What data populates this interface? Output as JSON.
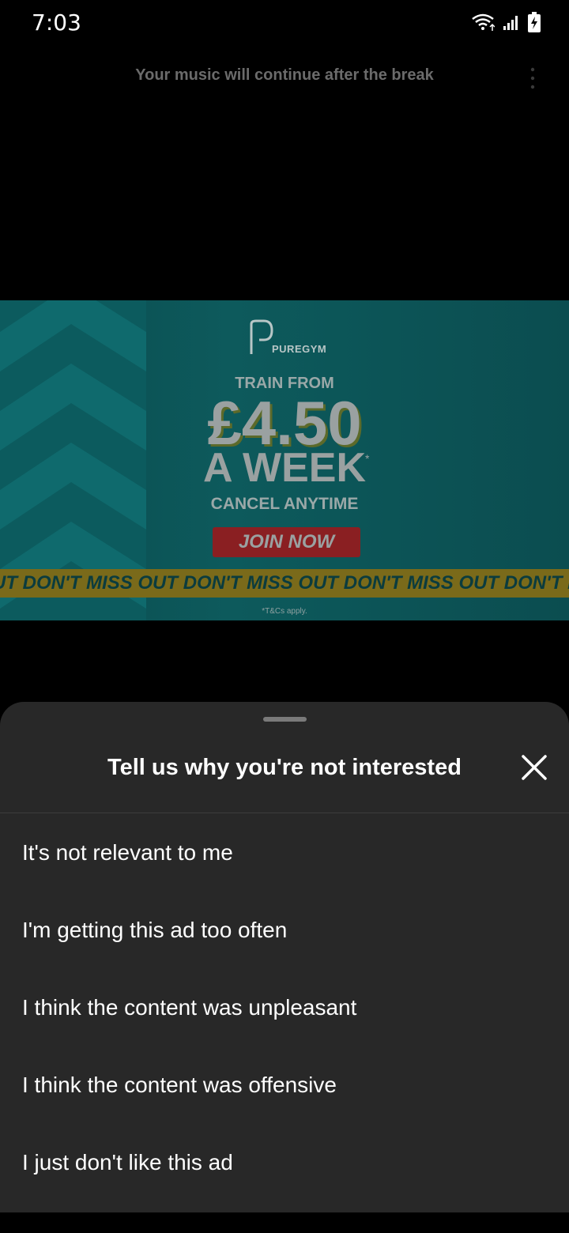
{
  "status_bar": {
    "time": "7:03"
  },
  "header": {
    "text": "Your music will continue after the break"
  },
  "ad": {
    "brand": "PUREGYM",
    "train_from": "TRAIN FROM",
    "price": "£4.50",
    "per_week": "A WEEK",
    "asterisk": "*",
    "cancel": "CANCEL ANYTIME",
    "cta": "JOIN NOW",
    "ribbon": "UT DON'T MISS OUT DON'T MISS OUT DON'T MISS OUT DON'T MISS",
    "terms": "*T&Cs apply."
  },
  "sheet": {
    "title": "Tell us why you're not interested",
    "options": [
      {
        "label": "It's not relevant to me"
      },
      {
        "label": "I'm getting this ad too often"
      },
      {
        "label": "I think the content was unpleasant"
      },
      {
        "label": "I think the content was offensive"
      },
      {
        "label": "I just don't like this ad"
      }
    ]
  },
  "colors": {
    "background": "#000000",
    "sheet": "#282828",
    "ad_teal": "#0d5a5c",
    "ad_red": "#8a1f22",
    "ad_yellow": "#7a6a1a"
  }
}
